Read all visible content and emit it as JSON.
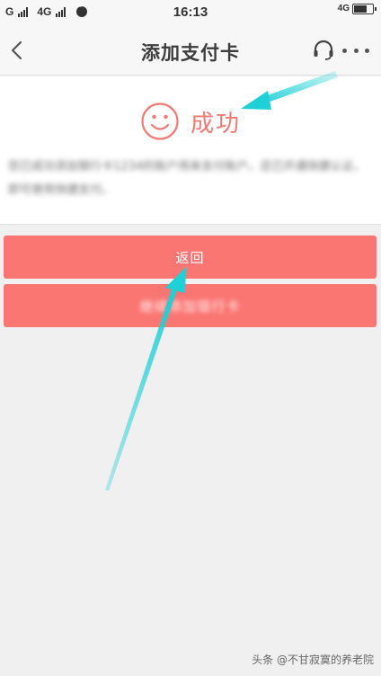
{
  "status_bar": {
    "carrier1": "G",
    "carrier2": "4G",
    "time": "16:13",
    "network": "4G"
  },
  "header": {
    "title": "添加支付卡",
    "back_icon": "chevron-left-icon",
    "headset_icon": "headset-icon",
    "more_icon": "more-dots-icon"
  },
  "result": {
    "status_text": "成功",
    "icon": "smile-icon",
    "color": "#ef7a72",
    "description": "您已成功添加银行卡1234的账户用来支付账户。还已开通快捷认证，即可使用快捷支付。"
  },
  "buttons": {
    "return_label": "返回",
    "secondary_label": "继续添加银行卡",
    "color": "#fa7673"
  },
  "watermark": {
    "text": "头条 @不甘寂寞的养老院"
  },
  "annotation": {
    "arrow_color": "#1fd0d6"
  }
}
